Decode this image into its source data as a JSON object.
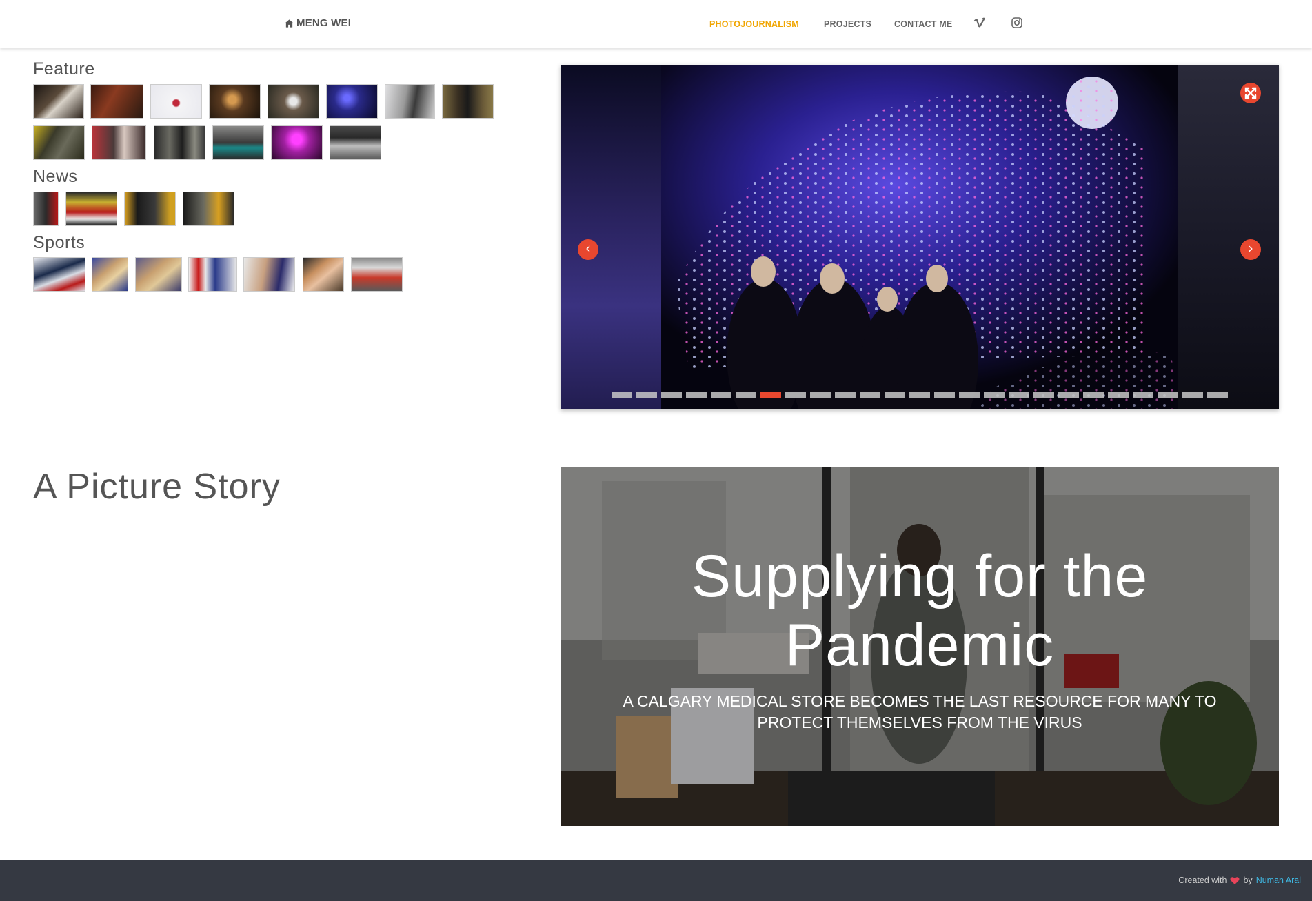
{
  "nav": {
    "brand": "MENG WEI",
    "items": [
      "PHOTOJOURNALISM",
      "PROJECTS",
      "CONTACT ME"
    ],
    "active_item": "PHOTOJOURNALISM",
    "social_icons": [
      "vimeo-icon",
      "instagram-icon"
    ],
    "accent_color": "#f0a500"
  },
  "gallery": {
    "sections": [
      {
        "title": "Feature",
        "thumbnail_count": 14
      },
      {
        "title": "News",
        "thumbnail_count": 4
      },
      {
        "title": "Sports",
        "thumbnail_count": 7
      }
    ]
  },
  "slider": {
    "slide_count": 25,
    "active_slide": 6,
    "arrow_color": "#e8472f",
    "prev_icon": "chevron-left-icon",
    "next_icon": "chevron-right-icon",
    "fullscreen_icon": "expand-icon"
  },
  "story": {
    "heading": "A Picture Story",
    "title": "Supplying for the Pandemic",
    "subtitle": "A CALGARY MEDICAL STORE BECOMES THE LAST RESOURCE FOR MANY TO PROTECT THEMSELVES FROM THE VIRUS"
  },
  "footer": {
    "created_with": "Created with",
    "by": "by",
    "author": "Numan Aral",
    "heart_color": "#e8445a",
    "background": "#353942"
  }
}
